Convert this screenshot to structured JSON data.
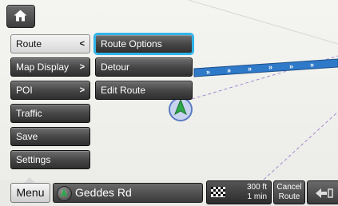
{
  "menu": {
    "button_label": "Menu",
    "items": [
      {
        "label": "Route",
        "arrow": "<",
        "active": true
      },
      {
        "label": "Map Display",
        "arrow": ">"
      },
      {
        "label": "POI",
        "arrow": ">"
      },
      {
        "label": "Traffic",
        "arrow": ""
      },
      {
        "label": "Save",
        "arrow": ""
      },
      {
        "label": "Settings",
        "arrow": ""
      }
    ]
  },
  "submenu": {
    "items": [
      {
        "label": "Route Options",
        "selected": true
      },
      {
        "label": "Detour"
      },
      {
        "label": "Edit Route"
      }
    ]
  },
  "status": {
    "road_name": "Geddes Rd",
    "next_turn_distance": "300 ft",
    "next_turn_time": "1 min",
    "cancel_line1": "Cancel",
    "cancel_line2": "Route"
  },
  "colors": {
    "route_blue": "#2f79c9",
    "highlight": "#2fb4e9",
    "vehicle_green": "#2ea84a"
  }
}
